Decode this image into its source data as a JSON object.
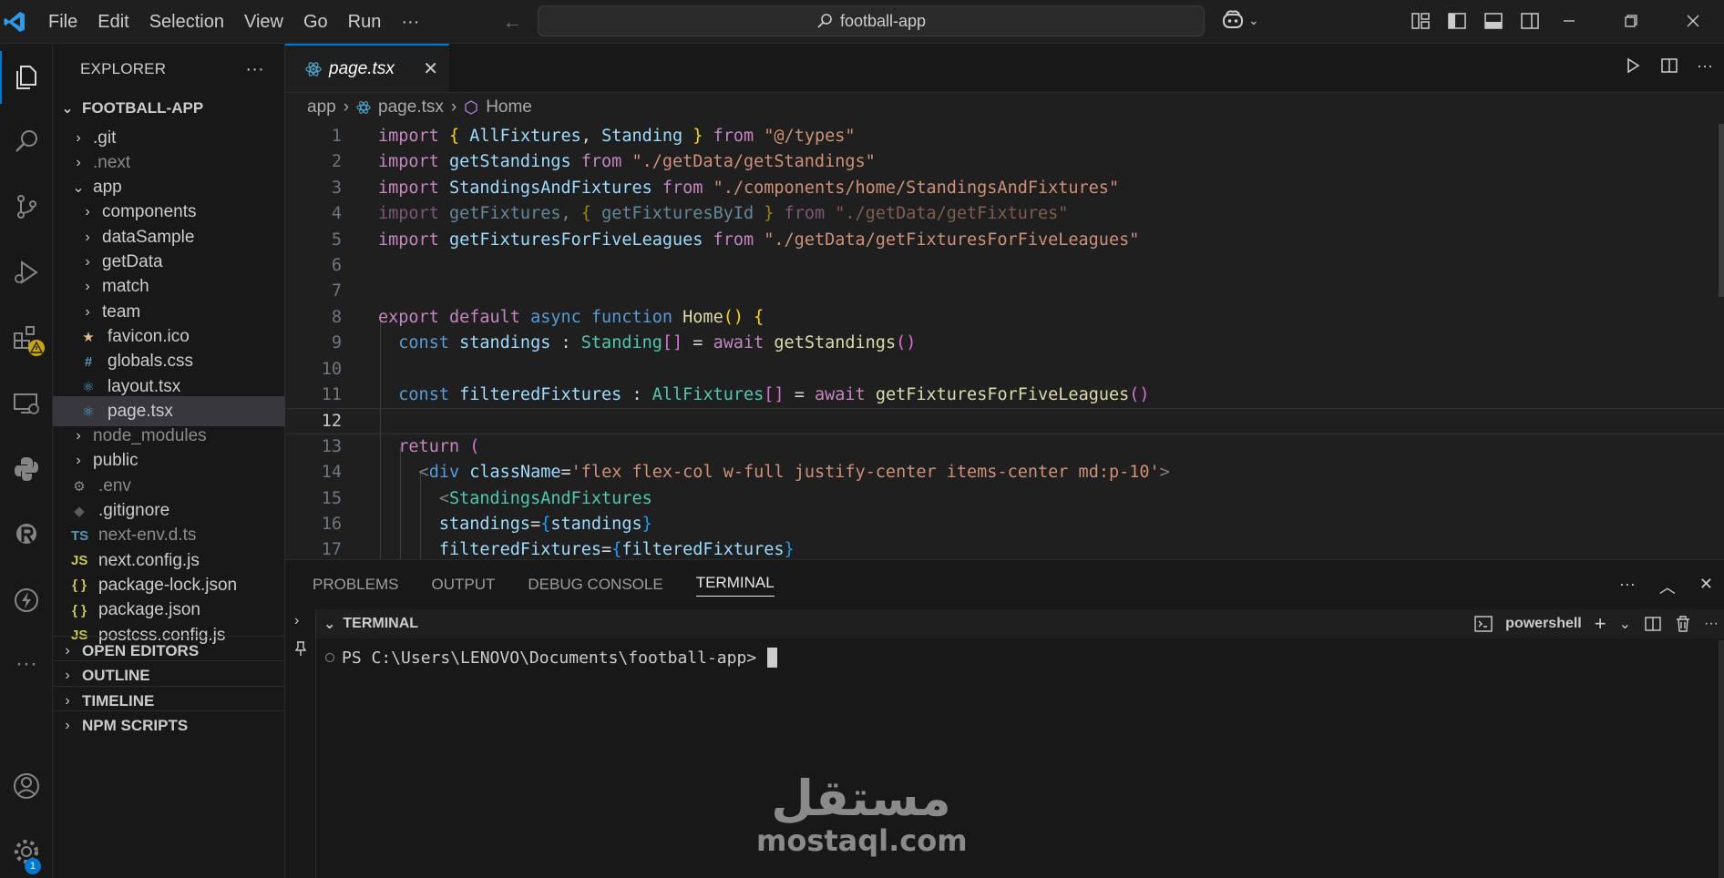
{
  "menu": [
    "File",
    "Edit",
    "Selection",
    "View",
    "Go",
    "Run",
    "···"
  ],
  "search": {
    "text": "football-app"
  },
  "explorer": {
    "title": "EXPLORER",
    "root": "FOOTBALL-APP",
    "items": [
      {
        "label": ".git",
        "depth": 1,
        "type": "folder",
        "open": false,
        "dim": false
      },
      {
        "label": ".next",
        "depth": 1,
        "type": "folder",
        "open": false,
        "dim": true
      },
      {
        "label": "app",
        "depth": 1,
        "type": "folder",
        "open": true,
        "dim": false
      },
      {
        "label": "components",
        "depth": 2,
        "type": "folder",
        "open": false,
        "dim": false
      },
      {
        "label": "dataSample",
        "depth": 2,
        "type": "folder",
        "open": false,
        "dim": false
      },
      {
        "label": "getData",
        "depth": 2,
        "type": "folder",
        "open": false,
        "dim": false
      },
      {
        "label": "match",
        "depth": 2,
        "type": "folder",
        "open": false,
        "dim": false
      },
      {
        "label": "team",
        "depth": 2,
        "type": "folder",
        "open": false,
        "dim": false
      },
      {
        "label": "favicon.ico",
        "depth": 2,
        "type": "star",
        "dim": false
      },
      {
        "label": "globals.css",
        "depth": 2,
        "type": "css",
        "dim": false
      },
      {
        "label": "layout.tsx",
        "depth": 2,
        "type": "react",
        "dim": false
      },
      {
        "label": "page.tsx",
        "depth": 2,
        "type": "react",
        "dim": false,
        "selected": true
      },
      {
        "label": "node_modules",
        "depth": 1,
        "type": "folder",
        "open": false,
        "dim": true
      },
      {
        "label": "public",
        "depth": 1,
        "type": "folder",
        "open": false,
        "dim": false
      },
      {
        "label": ".env",
        "depth": 1,
        "type": "gear",
        "dim": true
      },
      {
        "label": ".gitignore",
        "depth": 1,
        "type": "git",
        "dim": false
      },
      {
        "label": "next-env.d.ts",
        "depth": 1,
        "type": "ts",
        "dim": true
      },
      {
        "label": "next.config.js",
        "depth": 1,
        "type": "js",
        "dim": false
      },
      {
        "label": "package-lock.json",
        "depth": 1,
        "type": "json",
        "dim": false
      },
      {
        "label": "package.json",
        "depth": 1,
        "type": "json",
        "dim": false
      },
      {
        "label": "postcss.config.js",
        "depth": 1,
        "type": "js",
        "dim": false
      }
    ],
    "sections": [
      "OPEN EDITORS",
      "OUTLINE",
      "TIMELINE",
      "NPM SCRIPTS"
    ]
  },
  "tab": {
    "label": "page.tsx"
  },
  "breadcrumb": [
    "app",
    "page.tsx",
    "Home"
  ],
  "code": {
    "current_line": 12,
    "lines": [
      [
        [
          "import ",
          "kw"
        ],
        [
          "{ ",
          "br1"
        ],
        [
          "AllFixtures",
          "var"
        ],
        [
          ", ",
          "plain"
        ],
        [
          "Standing",
          "var"
        ],
        [
          " }",
          "br1"
        ],
        [
          " from ",
          "kw"
        ],
        [
          "\"@/types\"",
          "str"
        ]
      ],
      [
        [
          "import ",
          "kw"
        ],
        [
          "getStandings",
          "var"
        ],
        [
          " from ",
          "kw"
        ],
        [
          "\"./getData/getStandings\"",
          "str"
        ]
      ],
      [
        [
          "import ",
          "kw"
        ],
        [
          "StandingsAndFixtures",
          "var"
        ],
        [
          " from ",
          "kw"
        ],
        [
          "\"./components/home/StandingsAndFixtures\"",
          "str"
        ]
      ],
      [
        [
          "import ",
          "kw faded"
        ],
        [
          "getFixtures",
          "var faded"
        ],
        [
          ", ",
          "plain faded"
        ],
        [
          "{ ",
          "br1 faded"
        ],
        [
          "getFixturesById",
          "var faded"
        ],
        [
          " }",
          "br1 faded"
        ],
        [
          " from ",
          "kw faded"
        ],
        [
          "\"./getData/getFixtures\"",
          "str faded"
        ]
      ],
      [
        [
          "import ",
          "kw"
        ],
        [
          "getFixturesForFiveLeagues",
          "var"
        ],
        [
          " from ",
          "kw"
        ],
        [
          "\"./getData/getFixturesForFiveLeagues\"",
          "str"
        ]
      ],
      [],
      [],
      [
        [
          "export ",
          "kw"
        ],
        [
          "default ",
          "kw"
        ],
        [
          "async ",
          "kwb"
        ],
        [
          "function ",
          "kwb"
        ],
        [
          "Home",
          "fn"
        ],
        [
          "() ",
          "br1"
        ],
        [
          "{",
          "br1"
        ]
      ],
      [
        [
          "  const ",
          "kwb"
        ],
        [
          "standings",
          "var"
        ],
        [
          " : ",
          "plain"
        ],
        [
          "Standing",
          "ty"
        ],
        [
          "[]",
          "br2"
        ],
        [
          " = ",
          "plain"
        ],
        [
          "await ",
          "kw"
        ],
        [
          "getStandings",
          "fn"
        ],
        [
          "()",
          "br2"
        ]
      ],
      [],
      [
        [
          "  const ",
          "kwb"
        ],
        [
          "filteredFixtures",
          "var"
        ],
        [
          " : ",
          "plain"
        ],
        [
          "AllFixtures",
          "ty"
        ],
        [
          "[]",
          "br2"
        ],
        [
          " = ",
          "plain"
        ],
        [
          "await ",
          "kw"
        ],
        [
          "getFixturesForFiveLeagues",
          "fn"
        ],
        [
          "()",
          "br2"
        ]
      ],
      [],
      [
        [
          "  return ",
          "kw"
        ],
        [
          "(",
          "br2"
        ]
      ],
      [
        [
          "    <",
          "tag"
        ],
        [
          "div ",
          "kwb"
        ],
        [
          "className",
          "var"
        ],
        [
          "=",
          "plain"
        ],
        [
          "'flex flex-col w-full justify-center items-center md:p-10'",
          "str"
        ],
        [
          ">",
          "tag"
        ]
      ],
      [
        [
          "      <",
          "tag"
        ],
        [
          "StandingsAndFixtures",
          "ty"
        ]
      ],
      [
        [
          "      standings",
          "var"
        ],
        [
          "=",
          "plain"
        ],
        [
          "{",
          "br3"
        ],
        [
          "standings",
          "var"
        ],
        [
          "}",
          "br3"
        ]
      ],
      [
        [
          "      filteredFixtures",
          "var"
        ],
        [
          "=",
          "plain"
        ],
        [
          "{",
          "br3"
        ],
        [
          "filteredFixtures",
          "var"
        ],
        [
          "}",
          "br3"
        ]
      ]
    ]
  },
  "panel": {
    "tabs": [
      "PROBLEMS",
      "OUTPUT",
      "DEBUG CONSOLE",
      "TERMINAL"
    ],
    "active_tab": "TERMINAL",
    "terminal_title": "TERMINAL",
    "shell": "powershell",
    "prompt": "PS C:\\Users\\LENOVO\\Documents\\football-app>"
  },
  "watermark": {
    "arabic": "مستقل",
    "latin": "mostaql.com"
  },
  "badges": {
    "accounts_settings": "1"
  },
  "colors": {
    "accent": "#0078d4",
    "warning": "#cca700"
  }
}
